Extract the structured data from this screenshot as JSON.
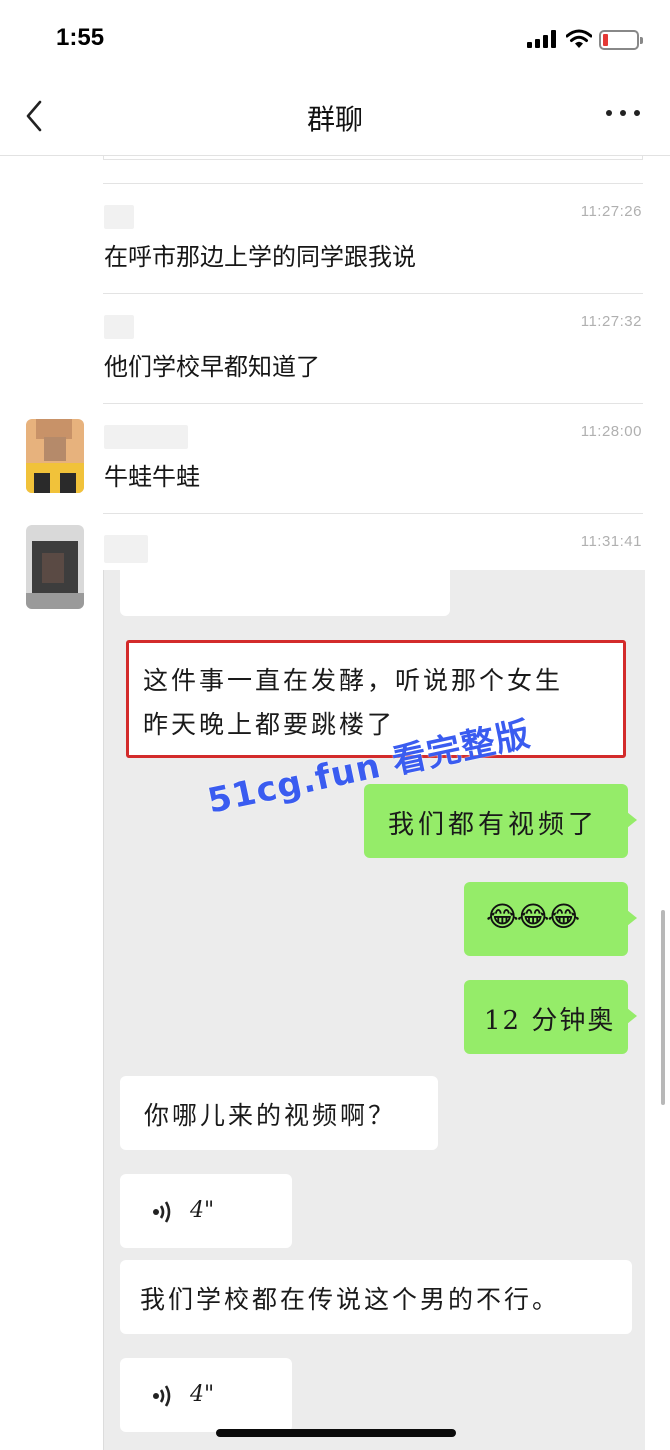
{
  "status_bar": {
    "time": "1:55"
  },
  "nav": {
    "title": "群聊"
  },
  "messages": [
    {
      "time": "11:27:26",
      "text": "在呼市那边上学的同学跟我说"
    },
    {
      "time": "11:27:32",
      "text": "他们学校早都知道了"
    },
    {
      "time": "11:28:00",
      "text": "牛蛙牛蛙"
    },
    {
      "time": "11:31:41"
    }
  ],
  "embedded_chat": {
    "highlighted_text_line1": "这件事一直在发酵，听说那个女生",
    "highlighted_text_line2": "昨天晚上都要跳楼了",
    "sent": [
      "我们都有视频了",
      "😂😂😂",
      "12 分钟奥"
    ],
    "received_question": "你哪儿来的视频啊？",
    "voice_1": "4\"",
    "received_rumor": "我们学校都在传说这个男的不行。",
    "voice_2": "4\"",
    "watermark": "51cg.fun 看完整版"
  },
  "colors": {
    "green_bubble": "#95ec69",
    "highlight_border": "#d32b2b",
    "watermark": "#3a5cf0"
  }
}
